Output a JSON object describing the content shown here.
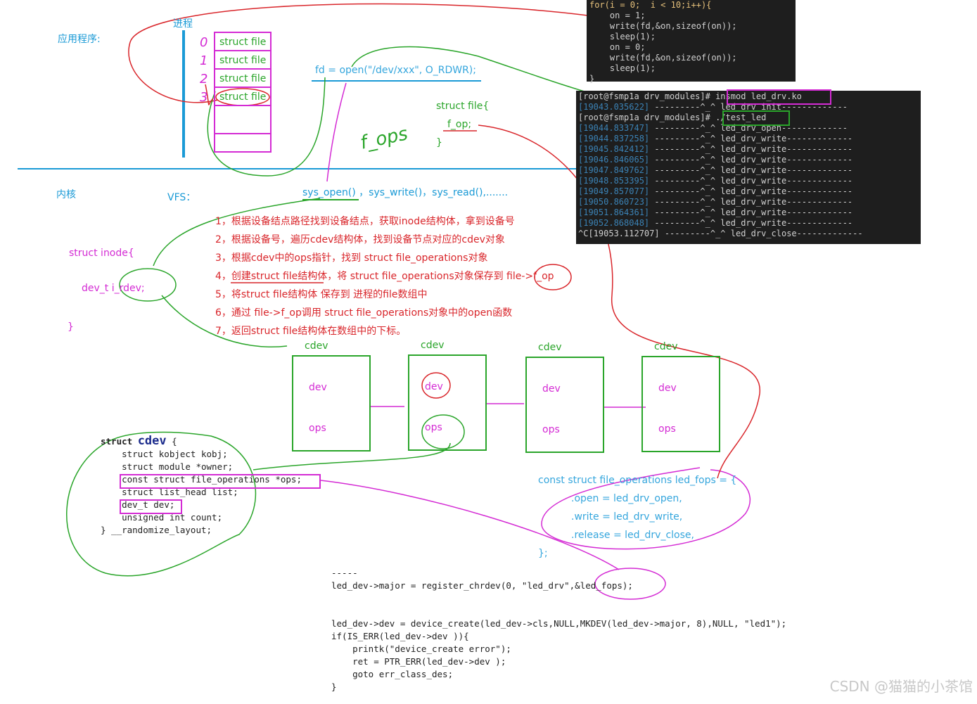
{
  "user_space": {
    "app_label": "应用程序:",
    "process_label": "进程",
    "fd_numbers": [
      "0",
      "1",
      "2",
      "3"
    ],
    "fd_table": [
      "struct file",
      "struct file",
      "struct file",
      "struct file"
    ],
    "open_call": "fd = open(\"/dev/xxx\", O_RDWR);",
    "struct_file": {
      "line1": "struct file{",
      "line2": "f_op;",
      "line3": "}"
    },
    "handwriting_label": "f_ops"
  },
  "write_code": {
    "lines": [
      "for(i = 0;  i < 10;i++){",
      "    on = 1;",
      "    write(fd,&on,sizeof(on));",
      "    sleep(1);",
      "    on = 0;",
      "    write(fd,&on,sizeof(on));",
      "    sleep(1);",
      "}"
    ]
  },
  "shell": {
    "prompt": "[root@fsmp1a drv_modules]#",
    "cmd1": " insmod led_drv.ko",
    "cmd2": "./test_led",
    "lines": [
      {
        "ts": "[19043.035622]",
        "msg": " ---------^_^ led_drv_init-------------"
      },
      {
        "ts": "[19044.833747]",
        "msg": " ---------^_^ led_drv_open-------------"
      },
      {
        "ts": "[19044.837258]",
        "msg": " ---------^_^ led_drv_write-------------"
      },
      {
        "ts": "[19045.842412]",
        "msg": " ---------^_^ led_drv_write-------------"
      },
      {
        "ts": "[19046.846065]",
        "msg": " ---------^_^ led_drv_write-------------"
      },
      {
        "ts": "[19047.849762]",
        "msg": " ---------^_^ led_drv_write-------------"
      },
      {
        "ts": "[19048.853395]",
        "msg": " ---------^_^ led_drv_write-------------"
      },
      {
        "ts": "[19049.857077]",
        "msg": " ---------^_^ led_drv_write-------------"
      },
      {
        "ts": "[19050.860723]",
        "msg": " ---------^_^ led_drv_write-------------"
      },
      {
        "ts": "[19051.864361]",
        "msg": " ---------^_^ led_drv_write-------------"
      },
      {
        "ts": "[19052.868048]",
        "msg": " ---------^_^ led_drv_write-------------"
      }
    ],
    "last_line": "^C[19053.112707] ---------^_^ led_drv_close-------------"
  },
  "kernel": {
    "label": "内核",
    "vfs": "VFS：",
    "syscalls": "sys_open() ，sys_write()，sys_read(),.......",
    "steps": [
      "1，根据设备结点路径找到设备结点，获取inode结构体，拿到设备号",
      "2，根据设备号，遍历cdev结构体，找到设备节点对应的cdev对象",
      "3，根据cdev中的ops指针，找到 struct file_operations对象",
      "4，创建struct file结构体，将 struct file_operations对象保存到 file->f_op",
      "5，将struct file结构体 保存到 进程的file数组中",
      "6，通过 file->f_op调用 struct file_operations对象中的open函数",
      "7，返回struct file结构体在数组中的下标。"
    ],
    "inode": {
      "line1": "struct  inode{",
      "line2": "dev_t    i_rdev;",
      "line3": "}"
    }
  },
  "cdev_list": [
    {
      "title": "cdev",
      "f1": "dev",
      "f2": "ops"
    },
    {
      "title": "cdev",
      "f1": "dev",
      "f2": "ops"
    },
    {
      "title": "cdev",
      "f1": "dev",
      "f2": "ops"
    },
    {
      "title": "cdev",
      "f1": "dev",
      "f2": "ops"
    }
  ],
  "struct_cdev": {
    "head_kw": "struct ",
    "head_name": "cdev",
    "head_brace": " {",
    "l1": "    struct kobject kobj;",
    "l2": "    struct module *owner;",
    "l3": "const struct file_operations *ops;",
    "l4": "    struct list_head list;",
    "l5": "dev_t dev;",
    "l6": "    unsigned int count;",
    "l7": "} __randomize_layout;"
  },
  "fops": {
    "head": "const struct file_operations  led_fops  = {",
    "open": ".open  =        led_drv_open,",
    "write": ".write  =        led_drv_write,",
    "release": ".release  =  led_drv_close,",
    "close": "};"
  },
  "register_code": {
    "dashes": "-----",
    "l1": "led_dev->major = register_chrdev(0, \"led_drv\",&led_fops);",
    "l2": "led_dev->dev = device_create(led_dev->cls,NULL,MKDEV(led_dev->major, 8),NULL, \"led1\");",
    "l3": "if(IS_ERR(led_dev->dev )){",
    "l4": "    printk(\"device_create error\");",
    "l5": "    ret = PTR_ERR(led_dev->dev );",
    "l6": "    goto err_class_des;",
    "l7": "}"
  },
  "watermark": "CSDN @猫猫的小茶馆"
}
